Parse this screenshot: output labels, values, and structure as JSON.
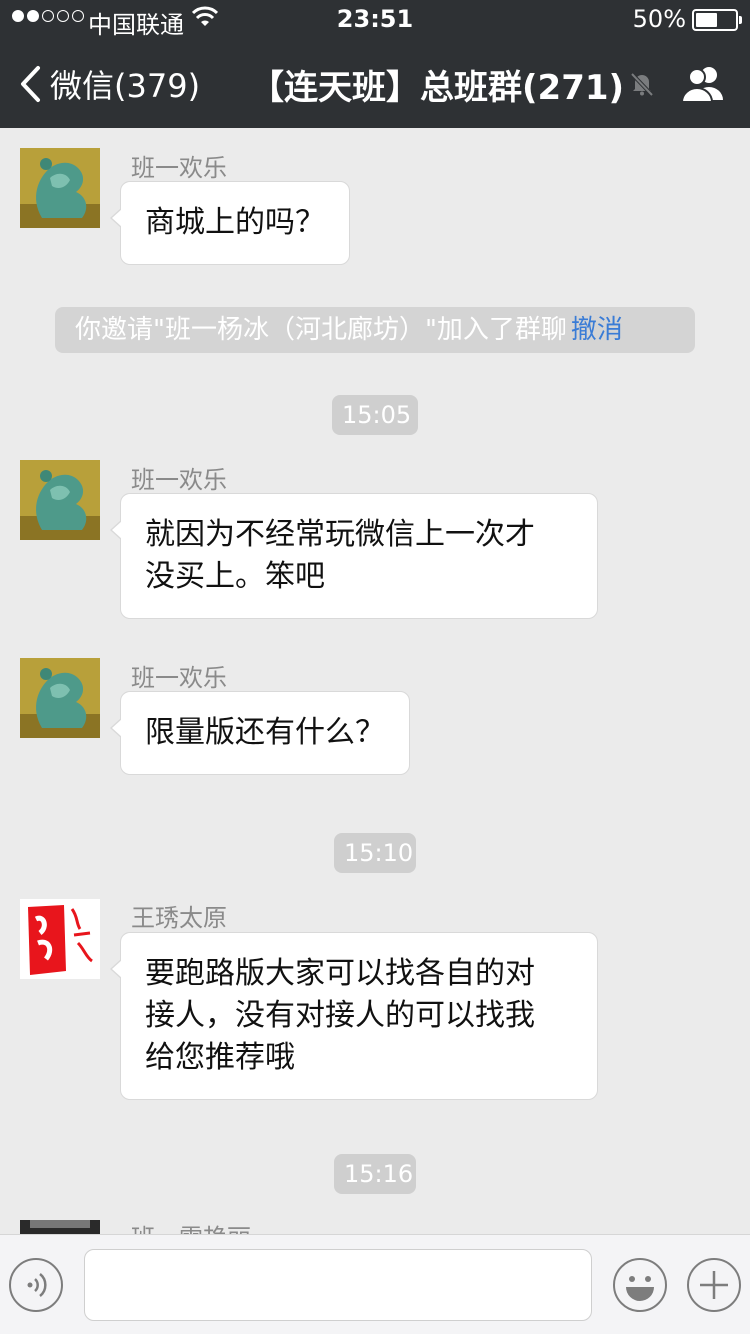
{
  "status_bar": {
    "carrier": "中国联通",
    "time": "23:51",
    "battery": "50%"
  },
  "nav": {
    "back_label": "微信(379)",
    "title": "【连天班】总班群(271)"
  },
  "messages": [
    {
      "sender": "班一欢乐",
      "text": "商城上的吗？",
      "avatar": "jade-sculpture-avatar"
    },
    {
      "system": "你邀请\"班一杨冰（河北廊坊）\"加入了群聊",
      "action": "撤消"
    },
    {
      "timestamp": "15:05"
    },
    {
      "sender": "班一欢乐",
      "lines": [
        "就因为不经常玩微信上一次才",
        "没买上。笨吧"
      ],
      "avatar": "jade-sculpture-avatar"
    },
    {
      "sender": "班一欢乐",
      "text": "限量版还有什么？",
      "avatar": "jade-sculpture-avatar"
    },
    {
      "timestamp": "15:10"
    },
    {
      "sender": "王琇太原",
      "lines": [
        "要跑路版大家可以找各自的对",
        "接人，没有对接人的可以找我",
        "给您推荐哦"
      ],
      "avatar": "red-calligraphy-avatar"
    },
    {
      "timestamp": "15:16"
    },
    {
      "sender": "班一雷艳丽",
      "avatar": "photo-avatar"
    }
  ],
  "colors": {
    "nav_bg": "#2e3134",
    "chat_bg": "#ebebeb",
    "link": "#3a7cd6",
    "avatar_red": "#e8151c"
  }
}
